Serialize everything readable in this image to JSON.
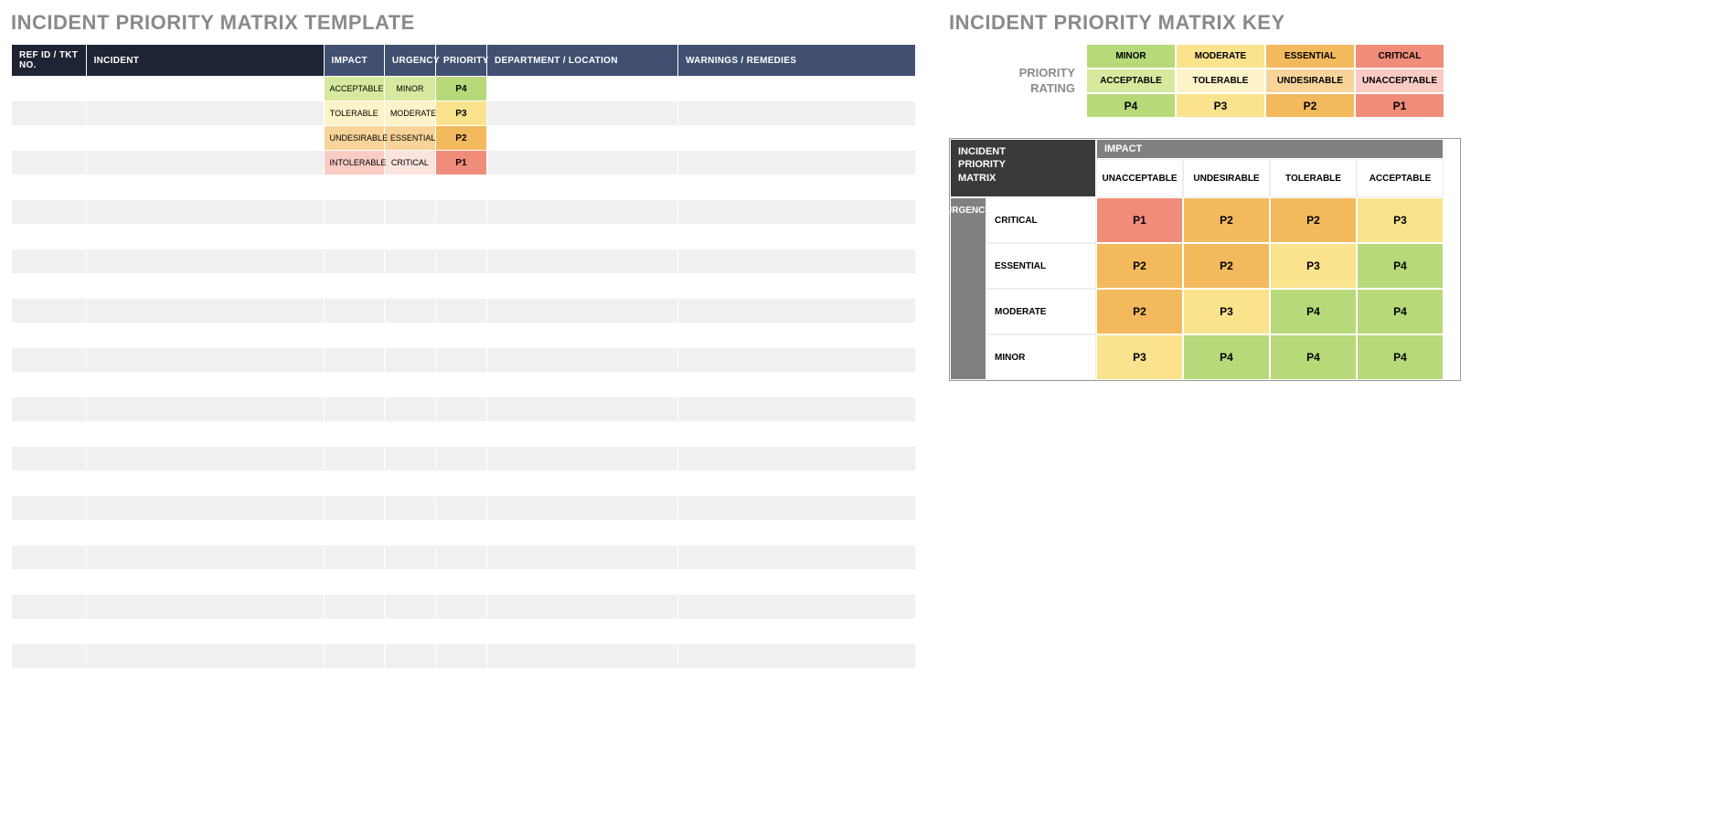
{
  "titles": {
    "template": "INCIDENT PRIORITY MATRIX TEMPLATE",
    "key": "INCIDENT PRIORITY MATRIX KEY"
  },
  "template_table": {
    "headers": {
      "ref": "REF ID / TKT NO.",
      "incident": "INCIDENT",
      "impact": "IMPACT",
      "urgency": "URGENCY",
      "priority": "PRIORITY",
      "department": "DEPARTMENT / LOCATION",
      "warnings": "WARNINGS / REMEDIES"
    },
    "rows": [
      {
        "impact": "ACCEPTABLE",
        "urgency": "MINOR",
        "priority": "P4",
        "imp_c": "c-green-l",
        "urg_c": "c-green-l",
        "pri_c": "c-green"
      },
      {
        "impact": "TOLERABLE",
        "urgency": "MODERATE",
        "priority": "P3",
        "imp_c": "c-yellow-l",
        "urg_c": "c-yellow-l",
        "pri_c": "c-yellow"
      },
      {
        "impact": "UNDESIRABLE",
        "urgency": "ESSENTIAL",
        "priority": "P2",
        "imp_c": "c-orange-l",
        "urg_c": "c-orange-l",
        "pri_c": "c-orange"
      },
      {
        "impact": "INTOLERABLE",
        "urgency": "CRITICAL",
        "priority": "P1",
        "imp_c": "c-red-l",
        "urg_c": "c-pink-l",
        "pri_c": "c-red"
      }
    ],
    "blank_rows": 20
  },
  "rating": {
    "label_line1": "PRIORITY",
    "label_line2": "RATING",
    "cols": [
      {
        "h": "MINOR",
        "c": "c-green",
        "t": "ACCEPTABLE",
        "tc": "c-green-l",
        "p": "P4",
        "pc": "c-green"
      },
      {
        "h": "MODERATE",
        "c": "c-yellow",
        "t": "TOLERABLE",
        "tc": "c-yellow-l",
        "p": "P3",
        "pc": "c-yellow"
      },
      {
        "h": "ESSENTIAL",
        "c": "c-orange",
        "t": "UNDESIRABLE",
        "tc": "c-orange-l",
        "p": "P2",
        "pc": "c-orange"
      },
      {
        "h": "CRITICAL",
        "c": "c-red",
        "t": "UNACCEPTABLE",
        "tc": "c-red-l",
        "p": "P1",
        "pc": "c-red"
      }
    ]
  },
  "matrix": {
    "corner": "INCIDENT PRIORITY MATRIX",
    "impact_head": "IMPACT",
    "urgency_head": "URGENCY",
    "impact_cols": [
      "UNACCEPTABLE",
      "UNDESIRABLE",
      "TOLERABLE",
      "ACCEPTABLE"
    ],
    "urgency_rows": [
      "CRITICAL",
      "ESSENTIAL",
      "MODERATE",
      "MINOR"
    ],
    "grid": [
      [
        {
          "v": "P1",
          "c": "c-red"
        },
        {
          "v": "P2",
          "c": "c-orange"
        },
        {
          "v": "P2",
          "c": "c-orange"
        },
        {
          "v": "P3",
          "c": "c-yellow"
        }
      ],
      [
        {
          "v": "P2",
          "c": "c-orange"
        },
        {
          "v": "P2",
          "c": "c-orange"
        },
        {
          "v": "P3",
          "c": "c-yellow"
        },
        {
          "v": "P4",
          "c": "c-green"
        }
      ],
      [
        {
          "v": "P2",
          "c": "c-orange"
        },
        {
          "v": "P3",
          "c": "c-yellow"
        },
        {
          "v": "P4",
          "c": "c-green"
        },
        {
          "v": "P4",
          "c": "c-green"
        }
      ],
      [
        {
          "v": "P3",
          "c": "c-yellow"
        },
        {
          "v": "P4",
          "c": "c-green"
        },
        {
          "v": "P4",
          "c": "c-green"
        },
        {
          "v": "P4",
          "c": "c-green"
        }
      ]
    ]
  }
}
